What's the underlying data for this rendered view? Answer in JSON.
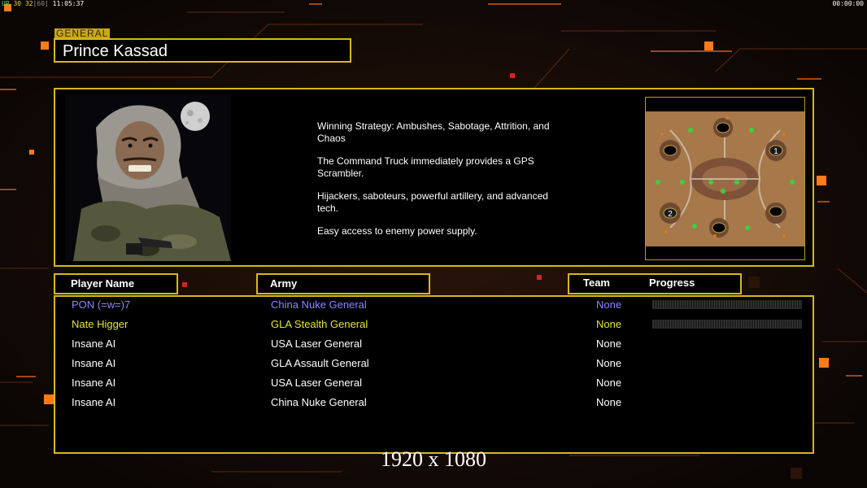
{
  "hud": {
    "prefix": "UR",
    "fps": "30",
    "fps_limit": "32",
    "fps_target": "[60]",
    "clock": "11:05:37",
    "timer": "00:00:00"
  },
  "general": {
    "tag": "GENERAL",
    "name": "Prince Kassad"
  },
  "description": [
    "Winning Strategy: Ambushes, Sabotage, Attrition, and Chaos",
    "The Command Truck immediately provides a GPS Scrambler.",
    "Hijackers, saboteurs, powerful artillery, and advanced tech.",
    "Easy access to enemy power supply."
  ],
  "minimap": {
    "start_positions": [
      "1",
      "2"
    ]
  },
  "table": {
    "headers": {
      "player_name": "Player Name",
      "army": "Army",
      "team": "Team",
      "progress": "Progress"
    },
    "rows": [
      {
        "name": "PON (=w=)7",
        "army": "China Nuke General",
        "team": "None",
        "color": "#8d86ff",
        "progress": 0
      },
      {
        "name": "Nate Higger",
        "army": "GLA Stealth General",
        "team": "None",
        "color": "#e4e43a",
        "progress": 0
      },
      {
        "name": "Insane AI",
        "army": "USA Laser General",
        "team": "None",
        "color": "#ffffff"
      },
      {
        "name": "Insane AI",
        "army": "GLA Assault General",
        "team": "None",
        "color": "#ffffff"
      },
      {
        "name": "Insane AI",
        "army": "USA Laser General",
        "team": "None",
        "color": "#ffffff"
      },
      {
        "name": "Insane AI",
        "army": "China Nuke General",
        "team": "None",
        "color": "#ffffff"
      }
    ]
  },
  "resolution": "1920 x 1080",
  "colors": {
    "frame": "#d6b81c",
    "accent": "#ff8a1c"
  }
}
